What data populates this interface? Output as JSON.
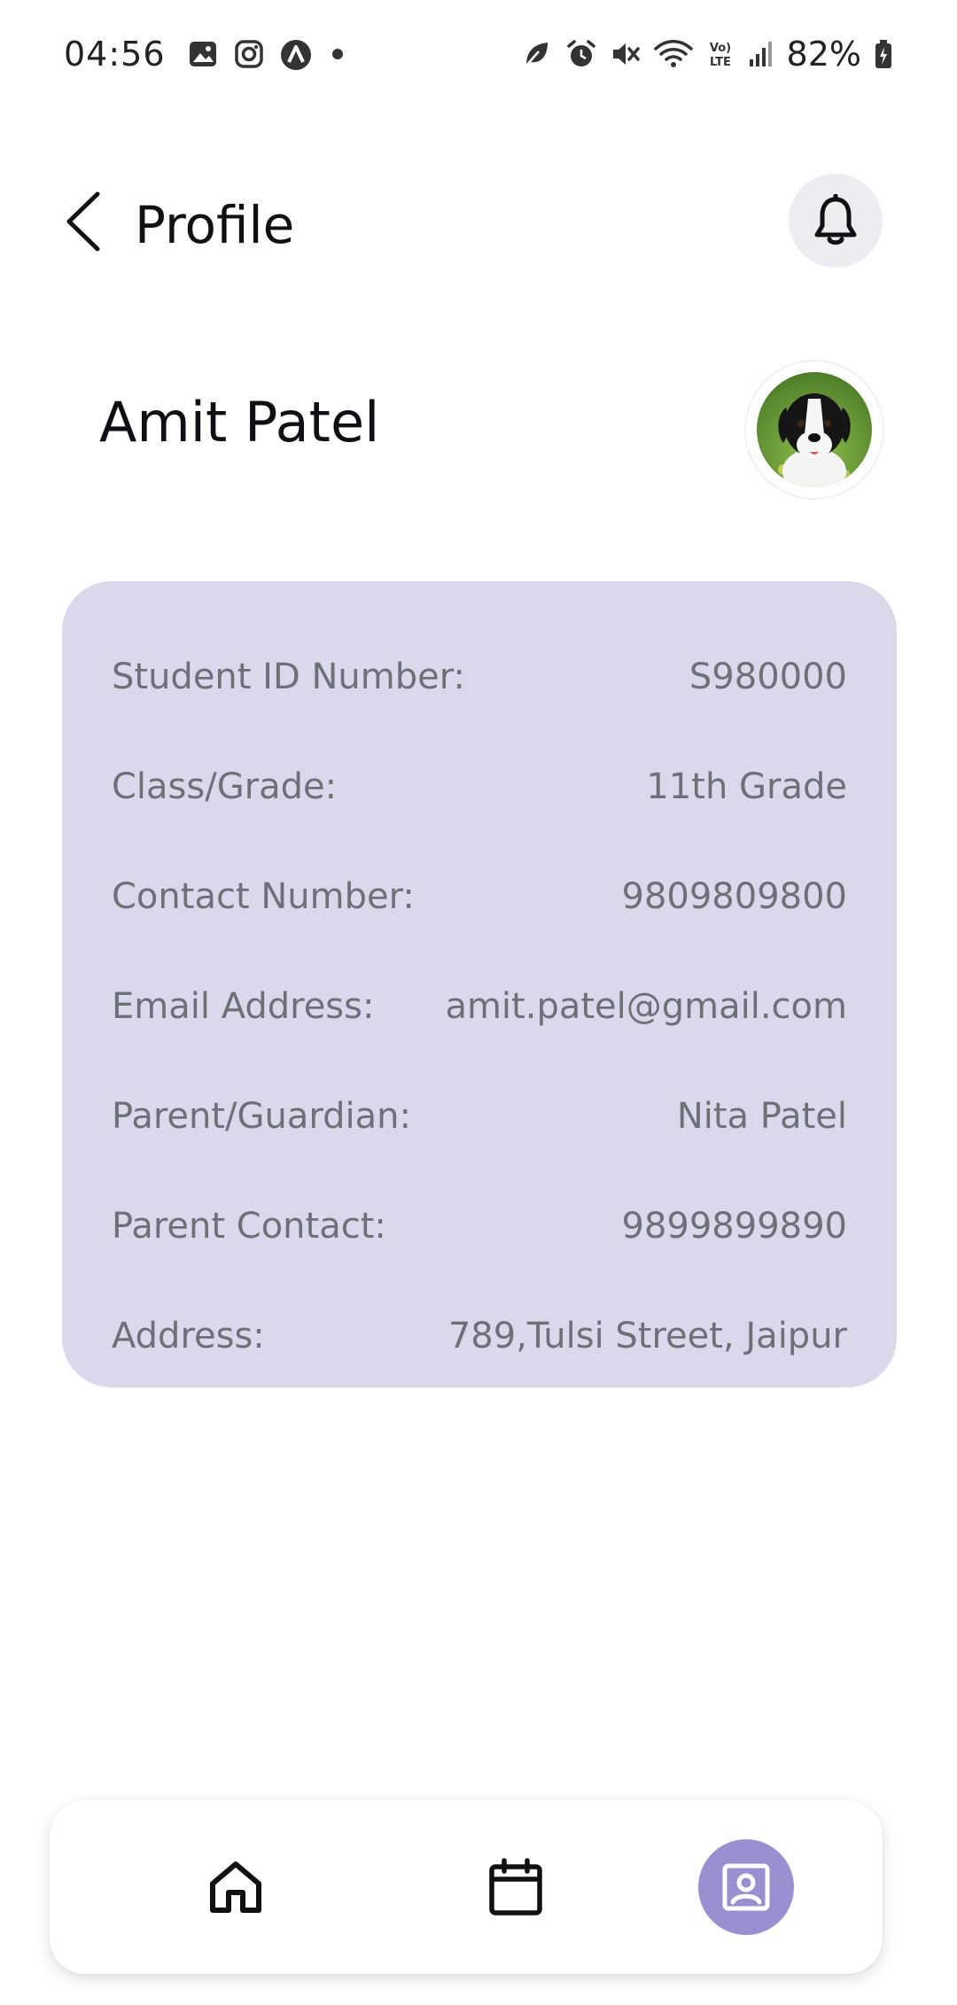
{
  "status_bar": {
    "time": "04:56",
    "battery": "82%",
    "left_icons": [
      "gallery-icon",
      "instagram-icon",
      "app-icon"
    ],
    "right_icons": [
      "leaf-icon",
      "alarm-icon",
      "mute-icon",
      "wifi-icon",
      "volte-icon",
      "signal-icon",
      "battery-icon"
    ]
  },
  "header": {
    "title": "Profile"
  },
  "profile": {
    "name": "Amit Patel"
  },
  "details": [
    {
      "label": "Student ID Number:",
      "value": "S980000"
    },
    {
      "label": "Class/Grade:",
      "value": "11th Grade"
    },
    {
      "label": "Contact Number:",
      "value": "9809809800"
    },
    {
      "label": "Email Address:",
      "value": "amit.patel@gmail.com"
    },
    {
      "label": "Parent/Guardian:",
      "value": "Nita Patel"
    },
    {
      "label": "Parent Contact:",
      "value": "9899899890"
    },
    {
      "label": "Address:",
      "value": "789,Tulsi Street, Jaipur"
    }
  ],
  "nav": {
    "items": [
      "home-icon",
      "calendar-icon",
      "profile-icon"
    ],
    "active": "profile"
  },
  "colors": {
    "card_bg": "#dcd8ec",
    "accent": "#9a8fd1",
    "bell_bg": "#ececf1",
    "label_text": "#6f6f78"
  }
}
